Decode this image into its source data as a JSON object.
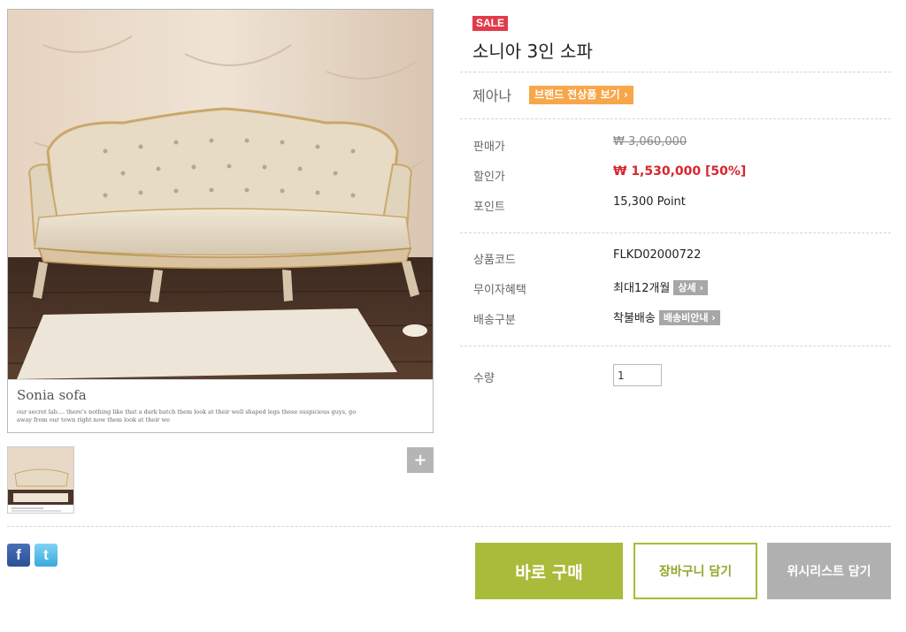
{
  "gallery": {
    "caption_title": "Sonia sofa",
    "caption_text": "our secret lab.... there's nothing like that a dark batch them look at their well shaped legs these suspicious guys, go away from our town right now them look at their we",
    "zoom_label": "+"
  },
  "social": {
    "facebook_label": "f",
    "twitter_label": "t"
  },
  "product": {
    "badge": "SALE",
    "name": "소니아 3인 소파",
    "brand": "제아나",
    "brand_link": "브랜드 전상품 보기 ›"
  },
  "pricing": {
    "list_price_label": "판매가",
    "list_price": "₩ 3,060,000",
    "sale_price_label": "할인가",
    "sale_price": "₩ 1,530,000 [50%]",
    "point_label": "포인트",
    "point": "15,300 Point"
  },
  "details": {
    "code_label": "상품코드",
    "code": "FLKD02000722",
    "installment_label": "무이자혜택",
    "installment": "최대12개월",
    "installment_btn": "상세 ›",
    "shipping_label": "배송구분",
    "shipping": "착불배송",
    "shipping_btn": "배송비안내 ›"
  },
  "quantity": {
    "label": "수량",
    "value": "1"
  },
  "actions": {
    "buy": "바로 구매",
    "cart": "장바구니 담기",
    "wishlist": "위시리스트 담기"
  },
  "colors": {
    "accent_green": "#a9bb3a",
    "sale_red": "#e23a4a",
    "brand_orange": "#f7a64a"
  }
}
